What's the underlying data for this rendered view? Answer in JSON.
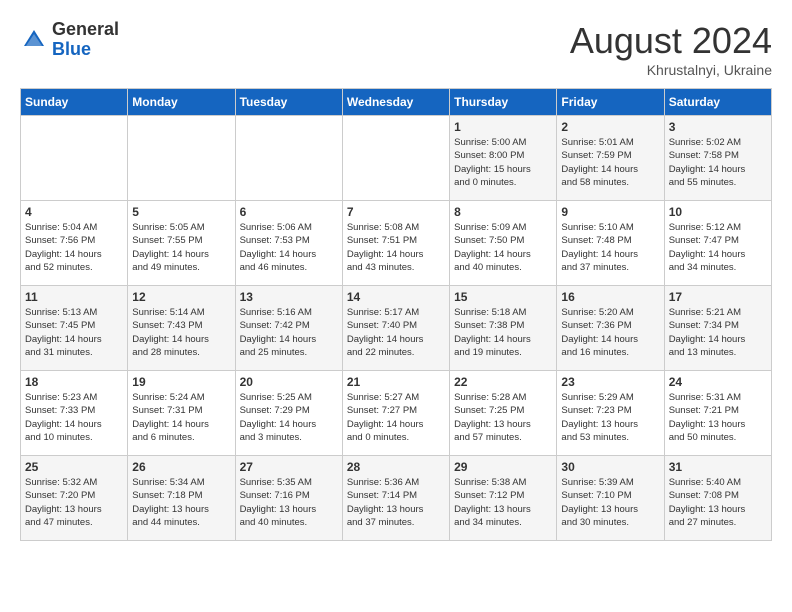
{
  "header": {
    "logo_general": "General",
    "logo_blue": "Blue",
    "month_year": "August 2024",
    "location": "Khrustalnyi, Ukraine"
  },
  "days_of_week": [
    "Sunday",
    "Monday",
    "Tuesday",
    "Wednesday",
    "Thursday",
    "Friday",
    "Saturday"
  ],
  "weeks": [
    [
      {
        "day": "",
        "info": ""
      },
      {
        "day": "",
        "info": ""
      },
      {
        "day": "",
        "info": ""
      },
      {
        "day": "",
        "info": ""
      },
      {
        "day": "1",
        "info": "Sunrise: 5:00 AM\nSunset: 8:00 PM\nDaylight: 15 hours\nand 0 minutes."
      },
      {
        "day": "2",
        "info": "Sunrise: 5:01 AM\nSunset: 7:59 PM\nDaylight: 14 hours\nand 58 minutes."
      },
      {
        "day": "3",
        "info": "Sunrise: 5:02 AM\nSunset: 7:58 PM\nDaylight: 14 hours\nand 55 minutes."
      }
    ],
    [
      {
        "day": "4",
        "info": "Sunrise: 5:04 AM\nSunset: 7:56 PM\nDaylight: 14 hours\nand 52 minutes."
      },
      {
        "day": "5",
        "info": "Sunrise: 5:05 AM\nSunset: 7:55 PM\nDaylight: 14 hours\nand 49 minutes."
      },
      {
        "day": "6",
        "info": "Sunrise: 5:06 AM\nSunset: 7:53 PM\nDaylight: 14 hours\nand 46 minutes."
      },
      {
        "day": "7",
        "info": "Sunrise: 5:08 AM\nSunset: 7:51 PM\nDaylight: 14 hours\nand 43 minutes."
      },
      {
        "day": "8",
        "info": "Sunrise: 5:09 AM\nSunset: 7:50 PM\nDaylight: 14 hours\nand 40 minutes."
      },
      {
        "day": "9",
        "info": "Sunrise: 5:10 AM\nSunset: 7:48 PM\nDaylight: 14 hours\nand 37 minutes."
      },
      {
        "day": "10",
        "info": "Sunrise: 5:12 AM\nSunset: 7:47 PM\nDaylight: 14 hours\nand 34 minutes."
      }
    ],
    [
      {
        "day": "11",
        "info": "Sunrise: 5:13 AM\nSunset: 7:45 PM\nDaylight: 14 hours\nand 31 minutes."
      },
      {
        "day": "12",
        "info": "Sunrise: 5:14 AM\nSunset: 7:43 PM\nDaylight: 14 hours\nand 28 minutes."
      },
      {
        "day": "13",
        "info": "Sunrise: 5:16 AM\nSunset: 7:42 PM\nDaylight: 14 hours\nand 25 minutes."
      },
      {
        "day": "14",
        "info": "Sunrise: 5:17 AM\nSunset: 7:40 PM\nDaylight: 14 hours\nand 22 minutes."
      },
      {
        "day": "15",
        "info": "Sunrise: 5:18 AM\nSunset: 7:38 PM\nDaylight: 14 hours\nand 19 minutes."
      },
      {
        "day": "16",
        "info": "Sunrise: 5:20 AM\nSunset: 7:36 PM\nDaylight: 14 hours\nand 16 minutes."
      },
      {
        "day": "17",
        "info": "Sunrise: 5:21 AM\nSunset: 7:34 PM\nDaylight: 14 hours\nand 13 minutes."
      }
    ],
    [
      {
        "day": "18",
        "info": "Sunrise: 5:23 AM\nSunset: 7:33 PM\nDaylight: 14 hours\nand 10 minutes."
      },
      {
        "day": "19",
        "info": "Sunrise: 5:24 AM\nSunset: 7:31 PM\nDaylight: 14 hours\nand 6 minutes."
      },
      {
        "day": "20",
        "info": "Sunrise: 5:25 AM\nSunset: 7:29 PM\nDaylight: 14 hours\nand 3 minutes."
      },
      {
        "day": "21",
        "info": "Sunrise: 5:27 AM\nSunset: 7:27 PM\nDaylight: 14 hours\nand 0 minutes."
      },
      {
        "day": "22",
        "info": "Sunrise: 5:28 AM\nSunset: 7:25 PM\nDaylight: 13 hours\nand 57 minutes."
      },
      {
        "day": "23",
        "info": "Sunrise: 5:29 AM\nSunset: 7:23 PM\nDaylight: 13 hours\nand 53 minutes."
      },
      {
        "day": "24",
        "info": "Sunrise: 5:31 AM\nSunset: 7:21 PM\nDaylight: 13 hours\nand 50 minutes."
      }
    ],
    [
      {
        "day": "25",
        "info": "Sunrise: 5:32 AM\nSunset: 7:20 PM\nDaylight: 13 hours\nand 47 minutes."
      },
      {
        "day": "26",
        "info": "Sunrise: 5:34 AM\nSunset: 7:18 PM\nDaylight: 13 hours\nand 44 minutes."
      },
      {
        "day": "27",
        "info": "Sunrise: 5:35 AM\nSunset: 7:16 PM\nDaylight: 13 hours\nand 40 minutes."
      },
      {
        "day": "28",
        "info": "Sunrise: 5:36 AM\nSunset: 7:14 PM\nDaylight: 13 hours\nand 37 minutes."
      },
      {
        "day": "29",
        "info": "Sunrise: 5:38 AM\nSunset: 7:12 PM\nDaylight: 13 hours\nand 34 minutes."
      },
      {
        "day": "30",
        "info": "Sunrise: 5:39 AM\nSunset: 7:10 PM\nDaylight: 13 hours\nand 30 minutes."
      },
      {
        "day": "31",
        "info": "Sunrise: 5:40 AM\nSunset: 7:08 PM\nDaylight: 13 hours\nand 27 minutes."
      }
    ]
  ]
}
